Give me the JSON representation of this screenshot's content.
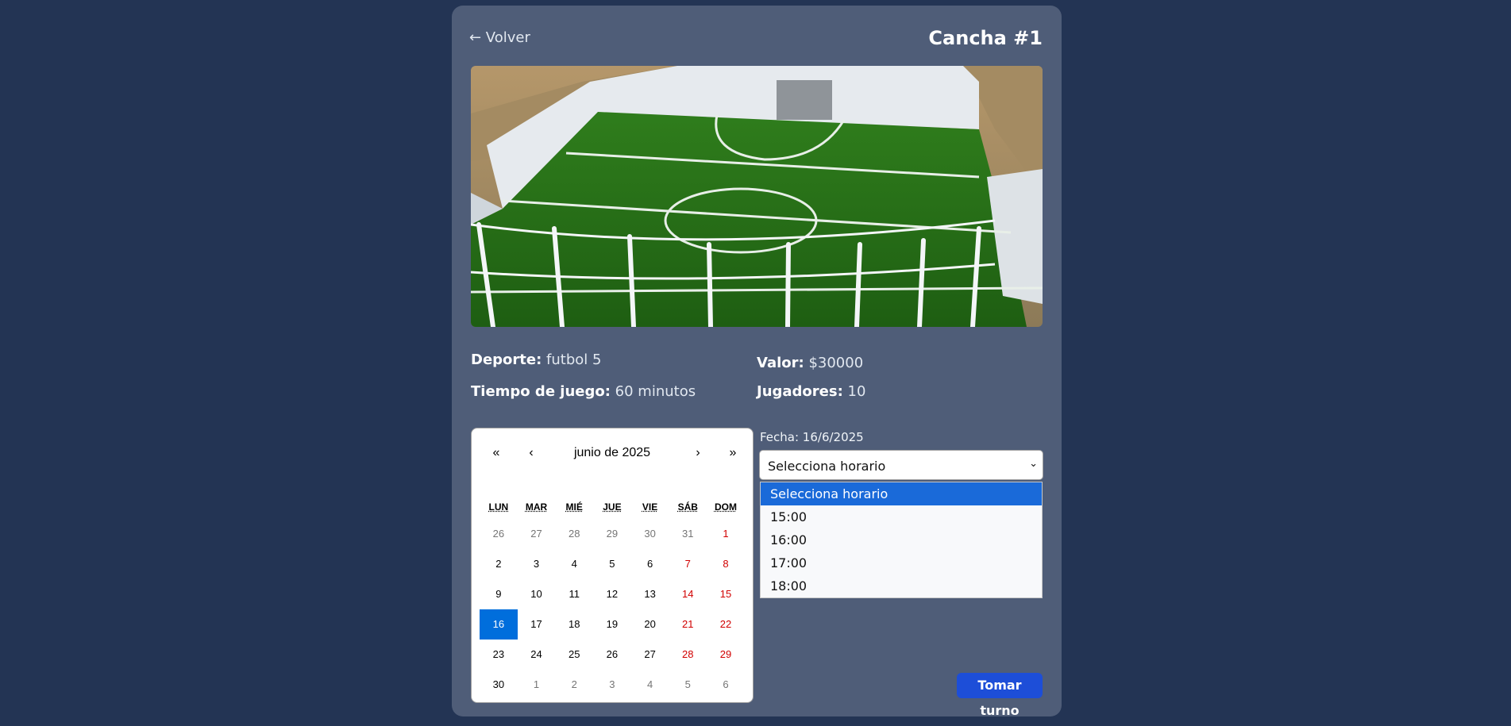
{
  "header": {
    "back_label": "← Volver",
    "title": "Cancha #1"
  },
  "details": {
    "deporte_label": "Deporte:",
    "deporte_value": "futbol 5",
    "valor_label": "Valor:",
    "valor_value": "$30000",
    "tiempo_label": "Tiempo de juego:",
    "tiempo_value": "60 minutos",
    "jugadores_label": "Jugadores:",
    "jugadores_value": "10"
  },
  "calendar": {
    "month_label": "junio de 2025",
    "nav": {
      "prev_year": "«",
      "prev_month": "‹",
      "next_month": "›",
      "next_year": "»"
    },
    "weekdays": [
      "LUN",
      "MAR",
      "MIÉ",
      "JUE",
      "VIE",
      "SÁB",
      "DOM"
    ],
    "weeks": [
      [
        "26",
        "27",
        "28",
        "29",
        "30",
        "31",
        "1"
      ],
      [
        "2",
        "3",
        "4",
        "5",
        "6",
        "7",
        "8"
      ],
      [
        "9",
        "10",
        "11",
        "12",
        "13",
        "14",
        "15"
      ],
      [
        "16",
        "17",
        "18",
        "19",
        "20",
        "21",
        "22"
      ],
      [
        "23",
        "24",
        "25",
        "26",
        "27",
        "28",
        "29"
      ],
      [
        "30",
        "1",
        "2",
        "3",
        "4",
        "5",
        "6"
      ]
    ],
    "selected_day": "16"
  },
  "booking": {
    "fecha_text": "Fecha: 16/6/2025",
    "select_value": "Selecciona horario",
    "options": [
      "Selecciona horario",
      "15:00",
      "16:00",
      "17:00",
      "18:00"
    ],
    "submit_label": "Tomar turno"
  },
  "colors": {
    "background": "#233454",
    "card": "#4f5d78",
    "accent": "#1d4ed8",
    "selected_day": "#006edc",
    "weekend": "#d10000"
  }
}
